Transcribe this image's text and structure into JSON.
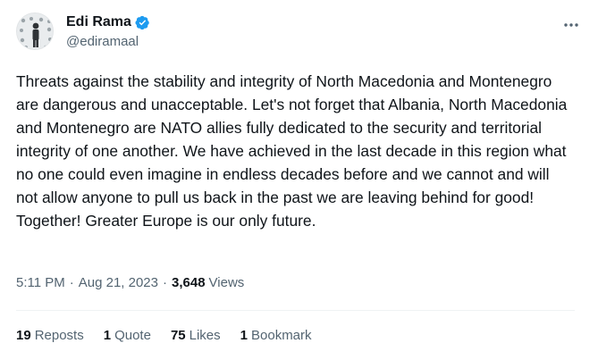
{
  "author": {
    "name": "Edi Rama",
    "handle": "@ediramaal",
    "verified_color": "#1d9bf0"
  },
  "more_icon": "more-horizontal-icon",
  "text": "Threats against the stability and integrity of North Macedonia and Montenegro are dangerous and unacceptable. Let's not forget that Albania, North Macedonia and Montenegro are NATO allies fully dedicated to the security and territorial integrity of one another. We have achieved in the last decade in this region what no one could even imagine in endless decades before and we cannot and will not allow anyone to pull us back in the past we are leaving behind for good! Together! Greater Europe is our only future.",
  "meta": {
    "time": "5:11 PM",
    "separator": "·",
    "date": "Aug 21, 2023",
    "views_count": "3,648",
    "views_label": "Views"
  },
  "stats": {
    "reposts": {
      "count": "19",
      "label": "Reposts"
    },
    "quotes": {
      "count": "1",
      "label": "Quote"
    },
    "likes": {
      "count": "75",
      "label": "Likes"
    },
    "bookmarks": {
      "count": "1",
      "label": "Bookmark"
    }
  }
}
